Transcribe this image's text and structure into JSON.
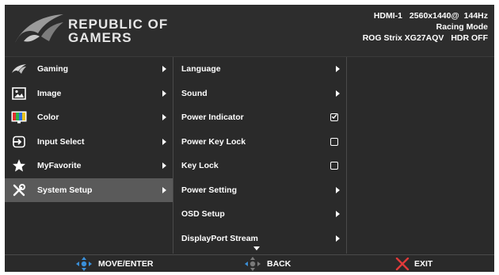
{
  "brand": {
    "line1": "REPUBLIC OF",
    "line2": "GAMERS"
  },
  "status": {
    "input": "HDMI-1",
    "resolution": "2560x1440@",
    "refresh": "144Hz",
    "mode": "Racing Mode",
    "model": "ROG Strix XG27AQV",
    "hdr": "HDR OFF"
  },
  "main_menu": [
    {
      "label": "Gaming",
      "icon": "rog-eye-icon"
    },
    {
      "label": "Image",
      "icon": "image-icon"
    },
    {
      "label": "Color",
      "icon": "color-bars-icon"
    },
    {
      "label": "Input Select",
      "icon": "input-icon"
    },
    {
      "label": "MyFavorite",
      "icon": "star-icon"
    },
    {
      "label": "System Setup",
      "icon": "wrench-icon",
      "selected": true
    }
  ],
  "sub_menu": [
    {
      "label": "Language",
      "control": "arrow"
    },
    {
      "label": "Sound",
      "control": "arrow"
    },
    {
      "label": "Power Indicator",
      "control": "checkbox",
      "checked": true
    },
    {
      "label": "Power Key Lock",
      "control": "checkbox",
      "checked": false
    },
    {
      "label": "Key Lock",
      "control": "checkbox",
      "checked": false
    },
    {
      "label": "Power Setting",
      "control": "arrow"
    },
    {
      "label": "OSD Setup",
      "control": "arrow"
    },
    {
      "label": "DisplayPort Stream",
      "control": "arrow"
    }
  ],
  "footer": {
    "move": "MOVE/ENTER",
    "back": "BACK",
    "exit": "EXIT"
  },
  "colors": {
    "accent": "#3a8fd8",
    "exit": "#e03a3a",
    "selected_bg": "#5a5a5a"
  }
}
